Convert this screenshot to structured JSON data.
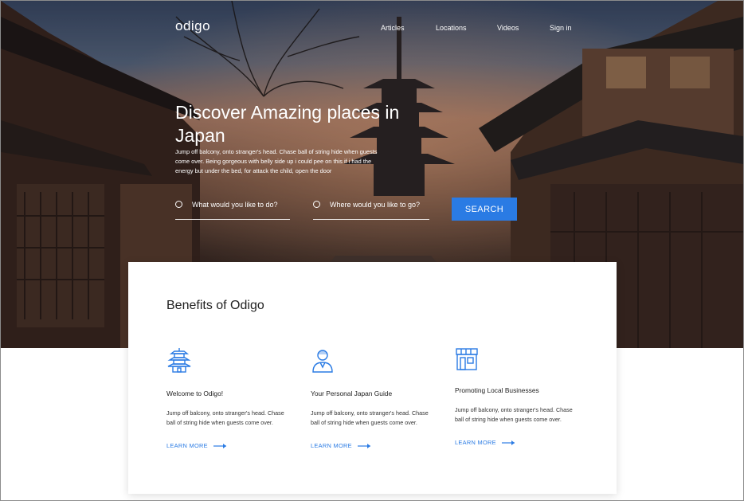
{
  "brand": {
    "logo": "odigo"
  },
  "nav": {
    "items": [
      "Articles",
      "Locations",
      "Videos",
      "Sign in"
    ]
  },
  "hero": {
    "title": "Discover Amazing places in Japan",
    "text": "Jump off balcony, onto stranger's head. Chase ball of string hide when guests come over. Being gorgeous with belly side up i could pee on this if i had the energy but under the bed, for attack the child, open the door"
  },
  "search": {
    "what_placeholder": "What would you like to do?",
    "where_placeholder": "Where would you like to go?",
    "button_label": "SEARCH"
  },
  "benefits": {
    "title": "Benefits of Odigo",
    "items": [
      {
        "icon": "pagoda-icon",
        "title": "Welcome to Odigo!",
        "text": "Jump off balcony, onto stranger's head. Chase ball of string hide when guests come over.",
        "link": "LEARN MORE"
      },
      {
        "icon": "person-guide-icon",
        "title": "Your Personal Japan Guide",
        "text": "Jump off balcony, onto stranger's head. Chase ball of string hide when guests come over.",
        "link": "LEARN MORE"
      },
      {
        "icon": "storefront-icon",
        "title": "Promoting Local Businesses",
        "text": "Jump off balcony, onto stranger's head. Chase ball of string hide when guests come over.",
        "link": "LEARN MORE"
      }
    ]
  },
  "colors": {
    "accent": "#2a7be4",
    "hero_text": "#ffffff",
    "card_bg": "#ffffff"
  }
}
